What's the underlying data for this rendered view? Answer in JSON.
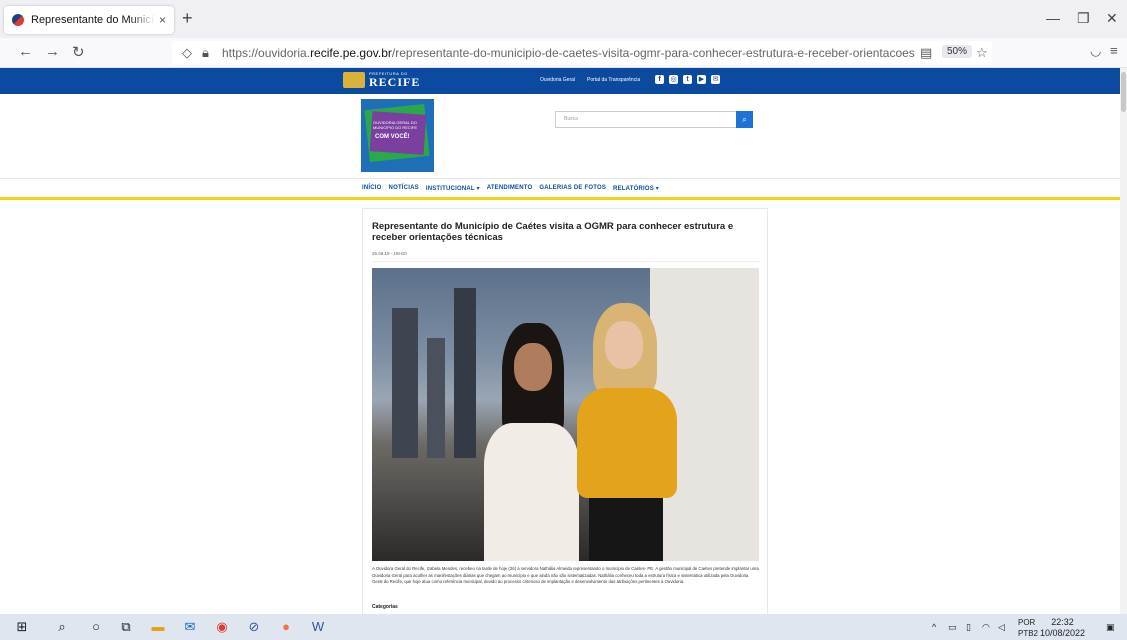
{
  "browser": {
    "tab_title": "Representante do Município de Caétes visita a OGMR",
    "tab_close": "×",
    "new_tab": "+",
    "url_prefix": "https://ouvidoria.",
    "url_domain": "recife.pe.gov.br",
    "url_path": "/representante-do-municipio-de-caetes-visita-ogmr-para-conhecer-estrutura-e-receber-orientacoes",
    "zoom": "50%",
    "window_controls": [
      "—",
      "❐",
      "✕"
    ]
  },
  "site": {
    "logo_small": "PREFEITURA DO",
    "logo_big": "RECIFE",
    "top_links": [
      "Ouvidoria Geral",
      "Portal da Transparência"
    ],
    "socials": [
      "f",
      "◎",
      "t",
      "▶",
      "✉"
    ],
    "ouv_logo_text": "OUVIDORIA GERAL DO MUNICÍPIO DO RECIFE",
    "ouv_logo_slogan": "COM VOCÊ!",
    "search_placeholder": "Busca",
    "menu": [
      "INÍCIO",
      "NOTÍCIAS",
      "INSTITUCIONAL ▾",
      "ATENDIMENTO",
      "GALERIAS DE FOTOS",
      "RELATÓRIOS ▾"
    ]
  },
  "article": {
    "title": "Representante do Município de Caétes visita a OGMR para conhecer estrutura e receber orientações técnicas",
    "date": "26.08.19 - 18H10",
    "body": "A Ouvidora Geral do Recife, Izabela Mendes, recebeu na tarde de hoje (26) a servidora Nathália Almeida representando o município de Caétes- PE. A gestão municipal de Caétes pretende implantar uma Ouvidoria Geral para acolher as manifestações diárias que chegam ao município e que ainda não são sistematizadas. Nathália conheceu toda a estrutura física e sistemática utilizada pela Ouvidoria Geral do Recife, que hoje atua como referência municipal, devido ao processo criterioso de implantação e desenvolvimento das atribuições pertinentes à Ouvidoria.",
    "categories_label": "Categorias"
  },
  "taskbar": {
    "lang_top": "POR",
    "lang_bottom": "PTB2",
    "time": "22:32",
    "date": "10/08/2022"
  }
}
